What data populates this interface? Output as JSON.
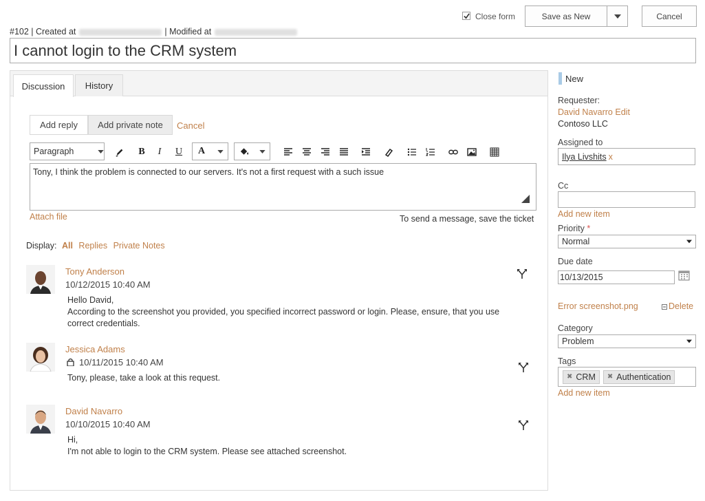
{
  "header": {
    "close_form_label": "Close form",
    "save_as_new_label": "Save as New",
    "cancel_label": "Cancel",
    "ticket_number": "#102",
    "created_prefix": "| Created at",
    "modified_prefix": "| Modified at",
    "title": "I cannot login to the CRM system"
  },
  "tabs": [
    {
      "label": "Discussion"
    },
    {
      "label": "History"
    }
  ],
  "reply": {
    "add_reply_label": "Add reply",
    "add_private_note_label": "Add private note",
    "cancel_label": "Cancel",
    "format_select": "Paragraph",
    "font_color_label": "A",
    "editor_text": "Tony, I think the problem is connected to our servers. It's not a first request with a such issue",
    "attach_file_label": "Attach file",
    "send_hint": "To send a message, save the ticket"
  },
  "display_filter": {
    "label": "Display:",
    "all": "All",
    "replies": "Replies",
    "private_notes": "Private Notes"
  },
  "messages": [
    {
      "author": "Tony Anderson",
      "date": "10/12/2015 10:40 AM",
      "private": false,
      "line1": "Hello David,",
      "line2": "According to the screenshot you provided, you specified incorrect password or login. Please, ensure, that you use",
      "line3": "correct credentials."
    },
    {
      "author": "Jessica Adams",
      "date": "10/11/2015 10:40 AM",
      "private": true,
      "line1": "Tony, please, take a look at this request."
    },
    {
      "author": "David Navarro",
      "date": "10/10/2015 10:40 AM",
      "private": false,
      "line1": "Hi,",
      "line2": "I'm not able to login to the CRM system. Please see attached screenshot."
    }
  ],
  "sidebar": {
    "status": "New",
    "requester_label": "Requester:",
    "requester_name": "David Navarro",
    "requester_edit": "Edit",
    "requester_company": "Contoso LLC",
    "assigned_label": "Assigned to",
    "assigned_value": "Ilya Livshits",
    "assigned_remove": "x",
    "cc_label": "Cc",
    "cc_add": "Add new item",
    "priority_label": "Priority",
    "priority_required": "*",
    "priority_value": "Normal",
    "due_label": "Due date",
    "due_value": "10/13/2015",
    "attachment_name": "Error screenshot.png",
    "attachment_delete": "Delete",
    "category_label": "Category",
    "category_value": "Problem",
    "tags_label": "Tags",
    "tags": [
      "CRM",
      "Authentication"
    ],
    "tags_add": "Add new item"
  },
  "colors": {
    "link": "#c0804a",
    "status_bar": "#a9cbe6",
    "panel_bg": "#f4f4f4"
  }
}
